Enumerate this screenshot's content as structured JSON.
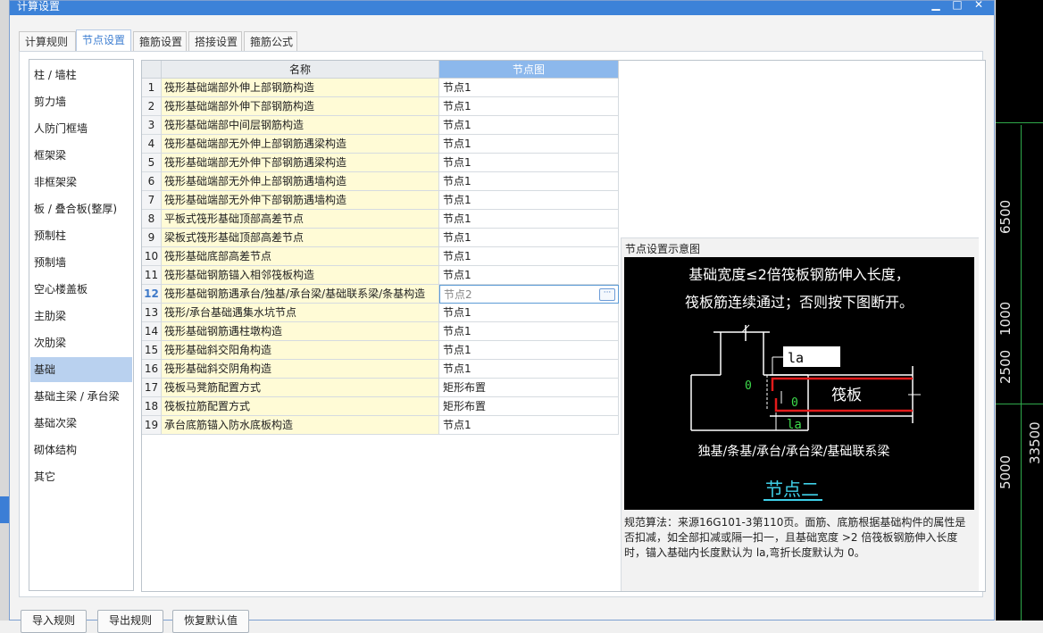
{
  "window": {
    "title": "计算设置",
    "minimize_icon": "minimize-icon",
    "maximize_icon": "maximize-icon",
    "close_icon": "close-icon"
  },
  "tabs": [
    {
      "label": "计算规则",
      "active": false
    },
    {
      "label": "节点设置",
      "active": true
    },
    {
      "label": "箍筋设置",
      "active": false
    },
    {
      "label": "搭接设置",
      "active": false
    },
    {
      "label": "箍筋公式",
      "active": false
    }
  ],
  "sidebar": {
    "items": [
      {
        "label": "柱 / 墙柱"
      },
      {
        "label": "剪力墙"
      },
      {
        "label": "人防门框墙"
      },
      {
        "label": "框架梁"
      },
      {
        "label": "非框架梁"
      },
      {
        "label": "板 / 叠合板(整厚)"
      },
      {
        "label": "预制柱"
      },
      {
        "label": "预制墙"
      },
      {
        "label": "空心楼盖板"
      },
      {
        "label": "主肋梁"
      },
      {
        "label": "次肋梁"
      },
      {
        "label": "基础",
        "active": true
      },
      {
        "label": "基础主梁 / 承台梁"
      },
      {
        "label": "基础次梁"
      },
      {
        "label": "砌体结构"
      },
      {
        "label": "其它"
      }
    ]
  },
  "grid": {
    "headers": {
      "name": "名称",
      "node": "节点图"
    },
    "selected_row": 12,
    "rows": [
      {
        "num": "1",
        "name": "筏形基础端部外伸上部钢筋构造",
        "value": "节点1"
      },
      {
        "num": "2",
        "name": "筏形基础端部外伸下部钢筋构造",
        "value": "节点1"
      },
      {
        "num": "3",
        "name": "筏形基础端部中间层钢筋构造",
        "value": "节点1"
      },
      {
        "num": "4",
        "name": "筏形基础端部无外伸上部钢筋遇梁构造",
        "value": "节点1"
      },
      {
        "num": "5",
        "name": "筏形基础端部无外伸下部钢筋遇梁构造",
        "value": "节点1"
      },
      {
        "num": "6",
        "name": "筏形基础端部无外伸上部钢筋遇墙构造",
        "value": "节点1"
      },
      {
        "num": "7",
        "name": "筏形基础端部无外伸下部钢筋遇墙构造",
        "value": "节点1"
      },
      {
        "num": "8",
        "name": "平板式筏形基础顶部高差节点",
        "value": "节点1"
      },
      {
        "num": "9",
        "name": "梁板式筏形基础顶部高差节点",
        "value": "节点1"
      },
      {
        "num": "10",
        "name": "筏形基础底部高差节点",
        "value": "节点1"
      },
      {
        "num": "11",
        "name": "筏形基础钢筋锚入相邻筏板构造",
        "value": "节点1"
      },
      {
        "num": "12",
        "name": "筏形基础钢筋遇承台/独基/承台梁/基础联系梁/条基构造",
        "value": "节点2"
      },
      {
        "num": "13",
        "name": "筏形/承台基础遇集水坑节点",
        "value": "节点1"
      },
      {
        "num": "14",
        "name": "筏形基础钢筋遇柱墩构造",
        "value": "节点1"
      },
      {
        "num": "15",
        "name": "筏形基础斜交阳角构造",
        "value": "节点1"
      },
      {
        "num": "16",
        "name": "筏形基础斜交阴角构造",
        "value": "节点1"
      },
      {
        "num": "17",
        "name": "筏板马凳筋配置方式",
        "value": "矩形布置"
      },
      {
        "num": "18",
        "name": "筏板拉筋配置方式",
        "value": "矩形布置"
      },
      {
        "num": "19",
        "name": "承台底筋锚入防水底板构造",
        "value": "节点1"
      }
    ],
    "ellipsis_label": "···"
  },
  "preview": {
    "title": "节点设置示意图",
    "diagram": {
      "line1": "基础宽度≤2倍筏板钢筋伸入长度，",
      "line2": "筏板筋连续通过；否则按下图断开。",
      "la_box": "la",
      "raft_label": "筏板",
      "la_bottom": "la",
      "o_left": "0",
      "o_right": "0",
      "members": "独基/条基/承台/承台梁/基础联系梁",
      "node_name": "节点二"
    },
    "description": "规范算法：来源16G101-3第110页。面筋、底筋根据基础构件的属性是否扣减，如全部扣减或隔一扣一，且基础宽度 >2 倍筏板钢筋伸入长度时，锚入基础内长度默认为 la,弯折长度默认为 0。"
  },
  "bottom_buttons": {
    "import": "导入规则",
    "export": "导出规则",
    "reset": "恢复默认值"
  },
  "cad": {
    "labels": [
      "6500",
      "1000",
      "2500",
      "5000",
      "33500"
    ],
    "colors": {
      "grid": "#2fa84a",
      "text": "#e8e8e8"
    }
  }
}
